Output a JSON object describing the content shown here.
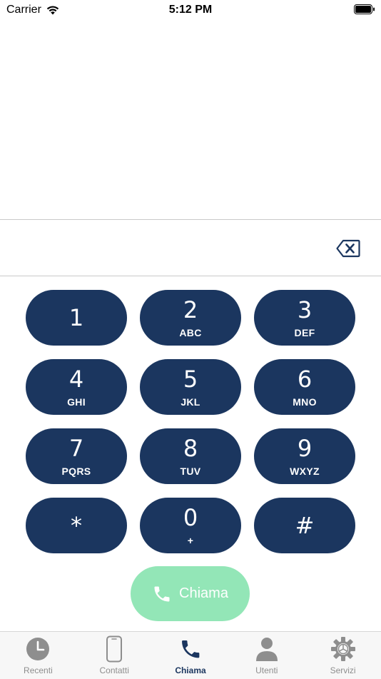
{
  "status_bar": {
    "carrier": "Carrier",
    "time": "5:12 PM"
  },
  "dialer": {
    "number": "",
    "keys": [
      {
        "digit": "1",
        "letters": ""
      },
      {
        "digit": "2",
        "letters": "ABC"
      },
      {
        "digit": "3",
        "letters": "DEF"
      },
      {
        "digit": "4",
        "letters": "GHI"
      },
      {
        "digit": "5",
        "letters": "JKL"
      },
      {
        "digit": "6",
        "letters": "MNO"
      },
      {
        "digit": "7",
        "letters": "PQRS"
      },
      {
        "digit": "8",
        "letters": "TUV"
      },
      {
        "digit": "9",
        "letters": "WXYZ"
      },
      {
        "digit": "*",
        "letters": ""
      },
      {
        "digit": "0",
        "letters": "+"
      },
      {
        "digit": "#",
        "letters": ""
      }
    ],
    "call_label": "Chiama"
  },
  "tab_bar": {
    "tabs": [
      {
        "label": "Recenti",
        "icon": "clock-icon"
      },
      {
        "label": "Contatti",
        "icon": "phone-device-icon"
      },
      {
        "label": "Chiama",
        "icon": "phone-handset-icon",
        "active": true
      },
      {
        "label": "Utenti",
        "icon": "user-icon"
      },
      {
        "label": "Servizi",
        "icon": "gear-icon"
      }
    ]
  },
  "colors": {
    "key_background": "#1b365f",
    "call_button": "#93e6b7",
    "tab_active": "#1b365f",
    "tab_inactive": "#8e8e8e"
  }
}
